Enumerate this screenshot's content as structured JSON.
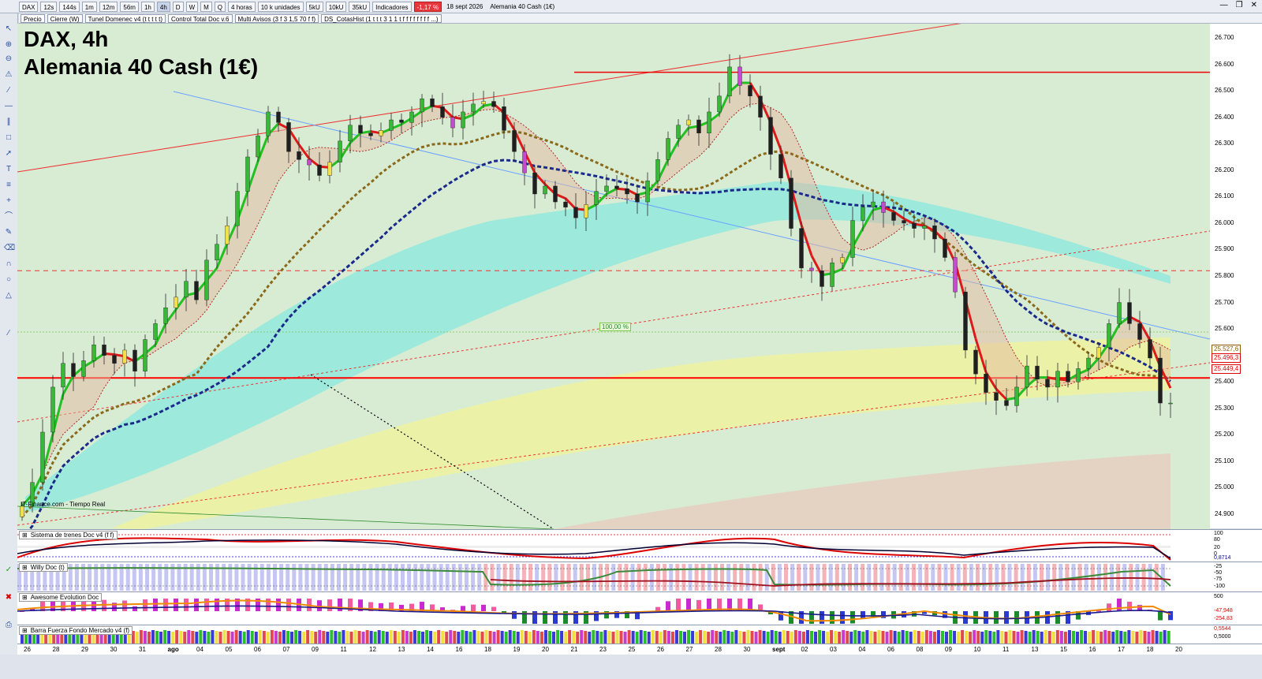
{
  "toolbar": {
    "symbol": "DAX",
    "timeframes": [
      "12s",
      "144s",
      "1m",
      "12m",
      "56m",
      "1h",
      "4h",
      "D",
      "W",
      "M",
      "Q"
    ],
    "selected_timeframe": "4h",
    "period": "4 horas",
    "volume_units": [
      "5kU",
      "10kU",
      "35kU"
    ],
    "units": "10 k unidades",
    "indicators_label": "Indicadores",
    "change": "-1,17 %",
    "date": "18 sept 2026",
    "instrument": "Alemania 40 Cash (1€)"
  },
  "toolbar2": {
    "chips": [
      "Precio",
      "Cierre (W)",
      "Tunel Domenec v4 (t t t t t)",
      "Control Total Doc v.6",
      "Multi Avisos (3 f 3 1,5 70 f f)",
      "DS_CotasHist (1 t t t 3 1 1 t f f f f f f f f ...)"
    ]
  },
  "chart": {
    "title_line1": "DAX, 4h",
    "title_line2": "Alemania 40 Cash (1€)",
    "source": "IT-Finance.com - Tiempo Real",
    "fib_label": "100,00 %"
  },
  "price_axis": {
    "ticks": [
      "26.700",
      "26.600",
      "26.500",
      "26.400",
      "26.300",
      "26.200",
      "26.100",
      "26.000",
      "25.900",
      "25.800",
      "25.700",
      "25.600",
      "25.500",
      "25.400",
      "25.300",
      "25.200",
      "25.100",
      "25.000",
      "24.900"
    ],
    "badges": [
      {
        "text": "25.527,6",
        "color": "#8a5a00"
      },
      {
        "text": "25.496,3",
        "color": "#d00000"
      },
      {
        "text": "25.449,4",
        "color": "#d00000"
      }
    ]
  },
  "panels": [
    {
      "title": "Sistema de trenes Doc v4 (f f)",
      "ticks": [
        "100",
        "80",
        "20",
        "0",
        "0,8714"
      ]
    },
    {
      "title": "Willy Doc (t)",
      "ticks": [
        "-25",
        "-50",
        "-75",
        "-100"
      ]
    },
    {
      "title": "Awesome Evolution Doc",
      "ticks": [
        "500",
        "-47,948",
        "-254,83"
      ]
    },
    {
      "title": "Barra Fuerza Fondo Mercado v4 (f)",
      "ticks": [
        "0,5544",
        "0,5000"
      ]
    }
  ],
  "chart_data": {
    "type": "candlestick",
    "title": "DAX, 4h",
    "subtitle": "Alemania 40 Cash (1€)",
    "x_tick_labels": [
      "26",
      "28",
      "29",
      "30",
      "31",
      "ago",
      "04",
      "05",
      "06",
      "07",
      "09",
      "11",
      "12",
      "13",
      "14",
      "16",
      "18",
      "19",
      "20",
      "21",
      "23",
      "25",
      "26",
      "27",
      "28",
      "30",
      "sept",
      "02",
      "03",
      "04",
      "06",
      "08",
      "09",
      "10",
      "11",
      "13",
      "15",
      "16",
      "17",
      "18",
      "20"
    ],
    "ylim": [
      24850,
      26750
    ],
    "horizontal_levels": [
      26570,
      25820,
      25415
    ],
    "close_series": [
      24930,
      25020,
      25210,
      25380,
      25470,
      25420,
      25480,
      25540,
      25500,
      25470,
      25520,
      25440,
      25560,
      25620,
      25680,
      25720,
      25780,
      25710,
      25860,
      25920,
      25990,
      26120,
      26250,
      26330,
      26420,
      26380,
      26270,
      26240,
      26220,
      26180,
      26230,
      26310,
      26370,
      26340,
      26330,
      26350,
      26390,
      26380,
      26420,
      26470,
      26440,
      26400,
      26360,
      26420,
      26450,
      26460,
      26440,
      26350,
      26270,
      26190,
      26110,
      26140,
      26080,
      26060,
      26020,
      26070,
      26120,
      26140,
      26130,
      26110,
      26080,
      26160,
      26240,
      26320,
      26370,
      26390,
      26340,
      26420,
      26480,
      26590,
      26520,
      26480,
      26400,
      26260,
      26170,
      25980,
      25830,
      25820,
      25760,
      25850,
      25870,
      26010,
      26060,
      26080,
      26040,
      26010,
      26000,
      25980,
      25990,
      25940,
      25870,
      25740,
      25520,
      25430,
      25360,
      25330,
      25310,
      25380,
      25460,
      25410,
      25380,
      25440,
      25400,
      25450,
      25490,
      25530,
      25620,
      25700,
      25620,
      25560,
      25490,
      25320,
      25320
    ]
  }
}
